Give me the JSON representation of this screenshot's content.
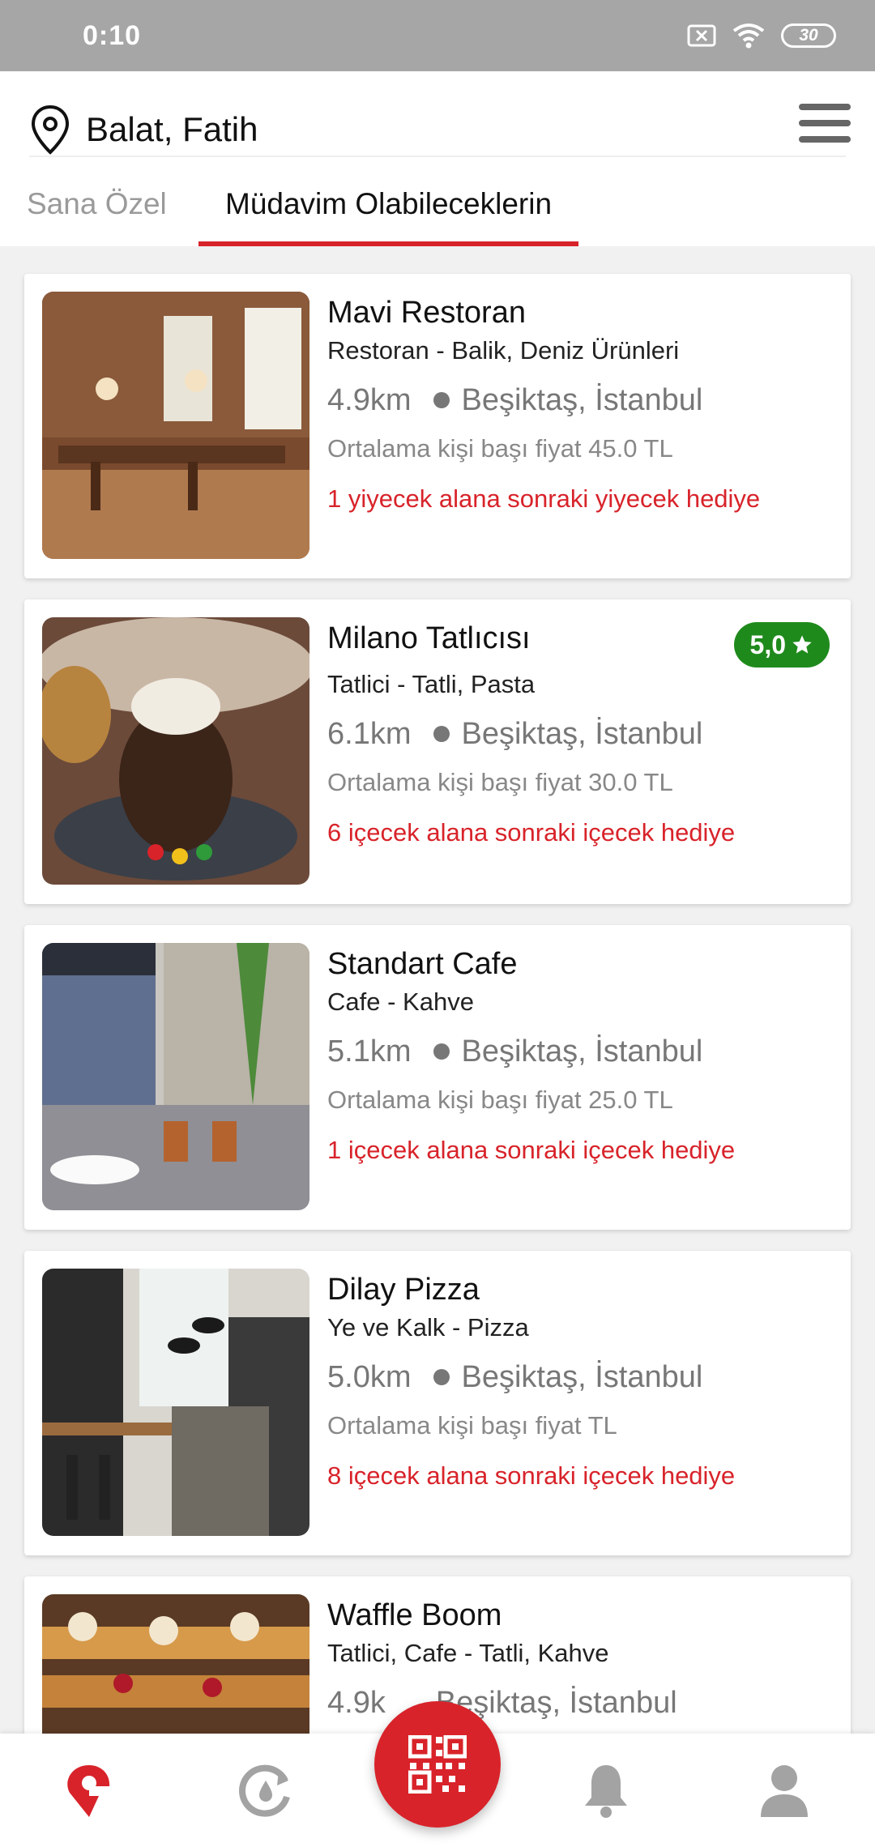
{
  "status_bar": {
    "time": "0:10",
    "battery": "30"
  },
  "header": {
    "location": "Balat, Fatih"
  },
  "tabs": [
    {
      "label": "Sana Özel",
      "active": false
    },
    {
      "label": "Müdavim Olabileceklerin",
      "active": true
    }
  ],
  "restaurants": [
    {
      "name": "Mavi Restoran",
      "category": "Restoran - Balik, Deniz Ürünleri",
      "distance": "4.9km",
      "district": "Beşiktaş, İstanbul",
      "price": "Ortalama kişi başı fiyat 45.0 TL",
      "promo": "1 yiyecek alana sonraki yiyecek hediye",
      "rating": ""
    },
    {
      "name": "Milano Tatlıcısı",
      "category": "Tatlici - Tatli, Pasta",
      "distance": "6.1km",
      "district": "Beşiktaş, İstanbul",
      "price": "Ortalama kişi başı fiyat 30.0 TL",
      "promo": "6 içecek alana sonraki içecek hediye",
      "rating": "5,0"
    },
    {
      "name": "Standart Cafe",
      "category": "Cafe - Kahve",
      "distance": "5.1km",
      "district": "Beşiktaş, İstanbul",
      "price": "Ortalama kişi başı fiyat 25.0 TL",
      "promo": "1 içecek alana sonraki içecek hediye",
      "rating": ""
    },
    {
      "name": "Dilay Pizza",
      "category": "Ye ve Kalk - Pizza",
      "distance": "5.0km",
      "district": "Beşiktaş, İstanbul",
      "price": "Ortalama kişi başı fiyat  TL",
      "promo": "8 içecek alana sonraki içecek hediye",
      "rating": ""
    },
    {
      "name": "Waffle Boom",
      "category": "Tatlici, Cafe - Tatli, Kahve",
      "distance": "4.9k",
      "district": "Beşiktaş, İstanbul",
      "price": "",
      "promo": "",
      "rating": ""
    }
  ],
  "colors": {
    "accent": "#d8232a",
    "rating_bg": "#1f8a1c",
    "status_bar": "#a6a6a6"
  },
  "bottom_nav": [
    "logo-icon",
    "refresh-icon",
    "qr-code-icon",
    "bell-icon",
    "profile-icon"
  ]
}
